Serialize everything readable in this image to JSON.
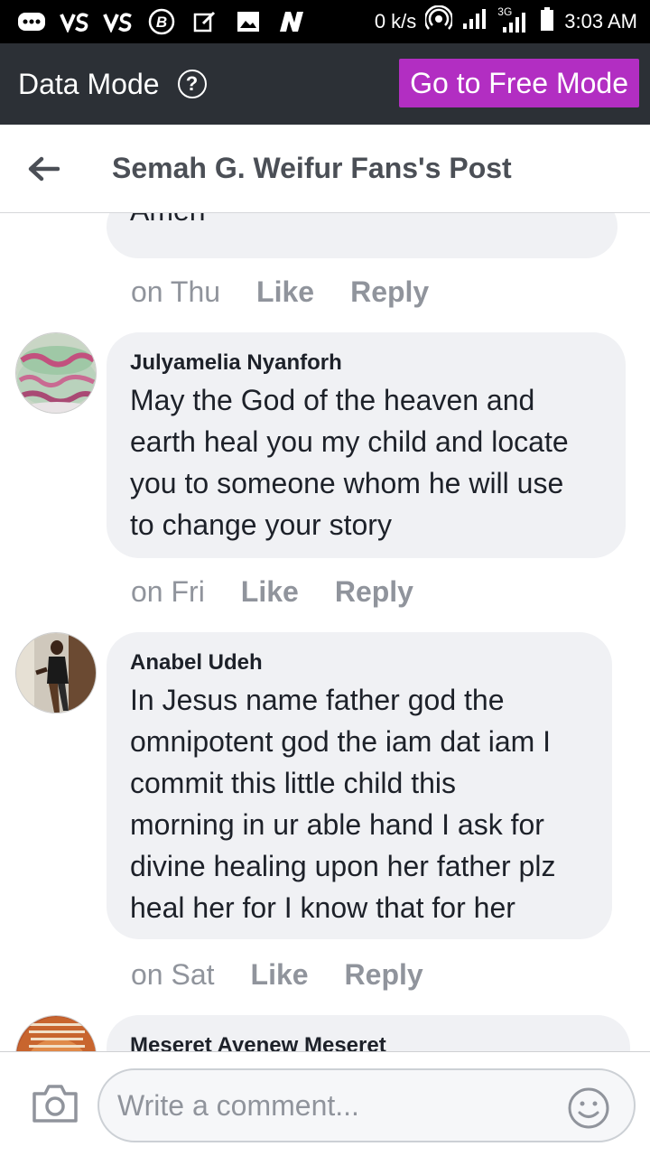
{
  "status_bar": {
    "speed": "0 k/s",
    "network": "3G",
    "time": "3:03 AM",
    "icons": [
      "bbm-icon",
      "vs-icon",
      "vs-icon",
      "b-icon",
      "edit-icon",
      "image-icon",
      "n-icon",
      "hotspot-icon",
      "signal-icon",
      "signal-3g-icon",
      "battery-icon"
    ]
  },
  "data_mode": {
    "label": "Data Mode",
    "help": "?",
    "button": "Go to Free Mode",
    "button_color": "#b22ec2"
  },
  "header": {
    "title": "Semah G. Weifur Fans's Post"
  },
  "comments": [
    {
      "author": "",
      "lines": [
        "Amen"
      ],
      "time": "on Thu",
      "like": "Like",
      "reply": "Reply"
    },
    {
      "author": "Julyamelia Nyanforh",
      "lines": [
        "May the God of the heaven and",
        "earth heal you my child and locate",
        "you to someone whom he will use",
        "to change your story"
      ],
      "time": "on Fri",
      "like": "Like",
      "reply": "Reply"
    },
    {
      "author": "Anabel Udeh",
      "lines": [
        "In Jesus name father god the",
        "omnipotent god the iam dat iam I",
        "commit this little child this",
        "morning in ur able hand I ask for",
        "divine healing upon her father plz",
        "heal her for I know that for her"
      ],
      "time": "on Sat",
      "like": "Like",
      "reply": "Reply"
    },
    {
      "author": "Meseret Ayenew Meseret"
    }
  ],
  "composer": {
    "placeholder": "Write a comment..."
  }
}
